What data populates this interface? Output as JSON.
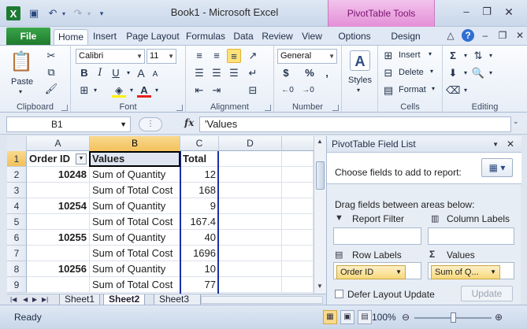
{
  "window": {
    "title": "Book1 - Microsoft Excel",
    "context_tab": "PivotTable Tools"
  },
  "ribbon_tabs": {
    "file": "File",
    "home": "Home",
    "insert": "Insert",
    "page_layout": "Page Layout",
    "formulas": "Formulas",
    "data": "Data",
    "review": "Review",
    "view": "View",
    "options": "Options",
    "design": "Design"
  },
  "clipboard": {
    "paste": "Paste",
    "group": "Clipboard"
  },
  "font": {
    "name": "Calibri",
    "size": "11",
    "bold": "B",
    "italic": "I",
    "underline": "U",
    "grow": "A",
    "shrink": "A",
    "group": "Font"
  },
  "alignment": {
    "group": "Alignment"
  },
  "number": {
    "format": "General",
    "currency": "$",
    "percent": "%",
    "comma": ",",
    "group": "Number"
  },
  "styles": {
    "label": "Styles"
  },
  "cells": {
    "insert": "Insert",
    "delete": "Delete",
    "format": "Format",
    "group": "Cells"
  },
  "editing": {
    "sum": "Σ",
    "group": "Editing"
  },
  "formula_bar": {
    "name_box": "B1",
    "fx": "fx",
    "value": "'Values"
  },
  "grid": {
    "columns": [
      "A",
      "B",
      "C",
      "D"
    ],
    "rows": [
      {
        "num": "1",
        "a": "Order ID",
        "b": "Values",
        "c": "Total"
      },
      {
        "num": "2",
        "a": "10248",
        "b": "Sum of Quantity",
        "c": "12"
      },
      {
        "num": "3",
        "a": "",
        "b": "Sum of Total Cost",
        "c": "168"
      },
      {
        "num": "4",
        "a": "10254",
        "b": "Sum of Quantity",
        "c": "9"
      },
      {
        "num": "5",
        "a": "",
        "b": "Sum of Total Cost",
        "c": "167.4"
      },
      {
        "num": "6",
        "a": "10255",
        "b": "Sum of Quantity",
        "c": "40"
      },
      {
        "num": "7",
        "a": "",
        "b": "Sum of Total Cost",
        "c": "1696"
      },
      {
        "num": "8",
        "a": "10256",
        "b": "Sum of Quantity",
        "c": "10"
      },
      {
        "num": "9",
        "a": "",
        "b": "Sum of Total Cost",
        "c": "77"
      }
    ]
  },
  "sheets": {
    "tab1": "Sheet1",
    "tab2": "Sheet2",
    "tab3": "Sheet3"
  },
  "pivot_pane": {
    "title": "PivotTable Field List",
    "choose": "Choose fields to add to report:",
    "drag": "Drag fields between areas below:",
    "report_filter": "Report Filter",
    "column_labels": "Column Labels",
    "row_labels": "Row Labels",
    "values": "Values",
    "row_field": "Order ID",
    "value_field": "Sum of Q...",
    "defer": "Defer Layout Update",
    "update": "Update"
  },
  "status": {
    "text": "Ready",
    "zoom": "100%"
  }
}
